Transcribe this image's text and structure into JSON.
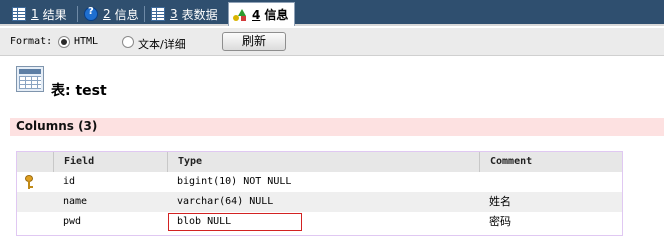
{
  "tabs": [
    {
      "num": "1",
      "label": "结果",
      "icon": "grid-icon",
      "active": false
    },
    {
      "num": "2",
      "label": "信息",
      "icon": "info-icon",
      "active": false
    },
    {
      "num": "3",
      "label": "表数据",
      "icon": "grid-icon",
      "active": false
    },
    {
      "num": "4",
      "label": "信息",
      "icon": "shapes-icon",
      "active": true
    }
  ],
  "format": {
    "label": "Format:",
    "options": [
      {
        "label": "HTML",
        "selected": true
      },
      {
        "label": "文本/详细",
        "selected": false
      }
    ],
    "refresh_label": "刷新"
  },
  "table_title": "表: test",
  "columns_section": "Columns (3)",
  "columns": {
    "headers": [
      "Field",
      "Type",
      "Comment"
    ],
    "rows": [
      {
        "primary_key": true,
        "field": "id",
        "type": "bigint(10) NOT NULL",
        "comment": ""
      },
      {
        "primary_key": false,
        "field": "name",
        "type": "varchar(64) NULL",
        "comment": "姓名"
      },
      {
        "primary_key": false,
        "field": "pwd",
        "type": "blob NULL",
        "comment": "密码"
      }
    ]
  },
  "colors": {
    "tabbar": "#2f4f6f",
    "columns_bar": "#fde1e1",
    "highlight_border": "#d22222"
  }
}
